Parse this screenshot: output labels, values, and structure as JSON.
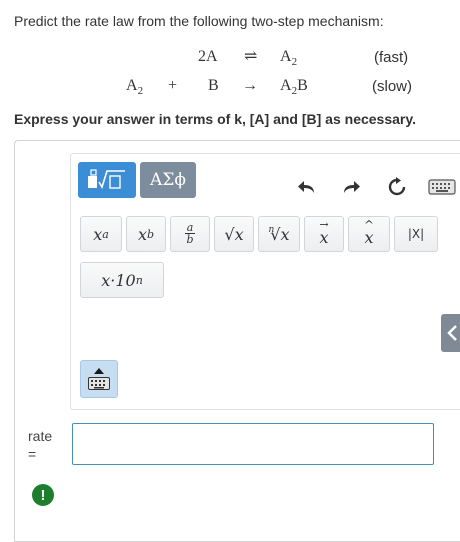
{
  "question": {
    "prompt": "Predict the rate law from the following two-step mechanism:",
    "step1": {
      "reactant_coef": "2A",
      "arrow": "⇌",
      "product_main": "A",
      "product_sub": "2",
      "rate": "(fast)"
    },
    "step2": {
      "reactant1_main": "A",
      "reactant1_sub": "2",
      "plus": "+",
      "reactant2": "B",
      "arrow": "→",
      "product_main": "A",
      "product_sub": "2",
      "product_tail": "B",
      "rate": "(slow)"
    },
    "instruction": "Express your answer in terms of k, [A] and [B] as necessary."
  },
  "editor": {
    "tabs": [
      {
        "name": "templates-tab",
        "icon": "templates-icon",
        "active": true
      },
      {
        "name": "greek-tab",
        "label": "ΑΣϕ",
        "active": false
      }
    ],
    "toolbar": [
      "undo-icon",
      "redo-icon",
      "reset-icon",
      "keyboard-icon"
    ],
    "keys": [
      {
        "name": "superscript",
        "label": "x",
        "sup": "a"
      },
      {
        "name": "subscript",
        "label": "x",
        "sub": "b"
      },
      {
        "name": "fraction",
        "num": "a",
        "den": "b"
      },
      {
        "name": "square-root",
        "label": "√x"
      },
      {
        "name": "nth-root",
        "index": "n",
        "label": "√x"
      },
      {
        "name": "vector",
        "label": "x",
        "accent": "→"
      },
      {
        "name": "hat",
        "label": "x",
        "accent": "^"
      },
      {
        "name": "absolute-value",
        "label": "|X|"
      },
      {
        "name": "scientific-notation",
        "label": "x·10",
        "sup": "n"
      }
    ],
    "accent_color": "#3b8dd6"
  },
  "answer": {
    "label_line1": "rate",
    "label_line2": "=",
    "value": ""
  },
  "alert": {
    "symbol": "!"
  }
}
